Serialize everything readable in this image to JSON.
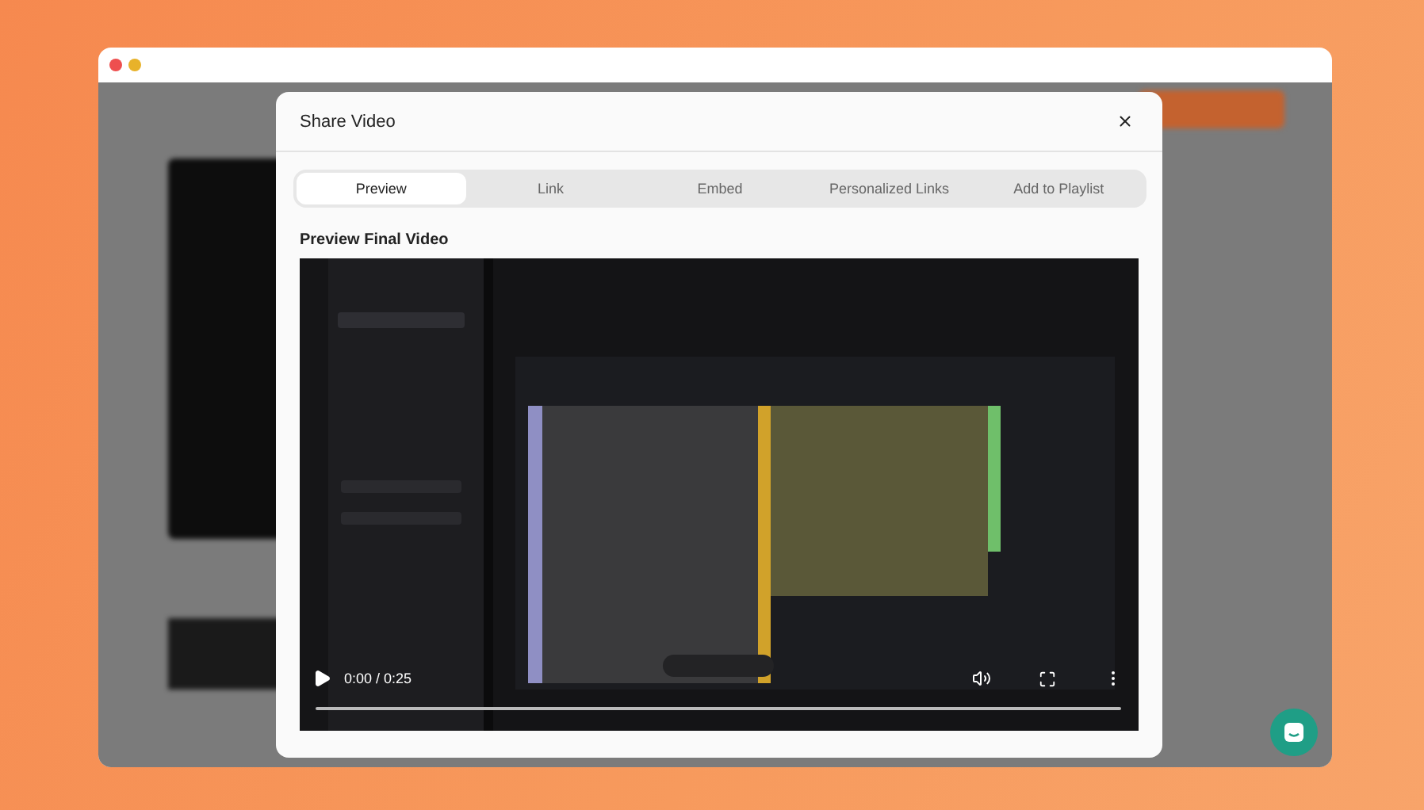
{
  "modal": {
    "title": "Share Video"
  },
  "tabs": [
    {
      "label": "Preview",
      "selected": true
    },
    {
      "label": "Link",
      "selected": false
    },
    {
      "label": "Embed",
      "selected": false
    },
    {
      "label": "Personalized Links",
      "selected": false
    },
    {
      "label": "Add to Playlist",
      "selected": false
    }
  ],
  "section_title": "Preview Final Video",
  "player": {
    "time": "0:00 / 0:25"
  }
}
